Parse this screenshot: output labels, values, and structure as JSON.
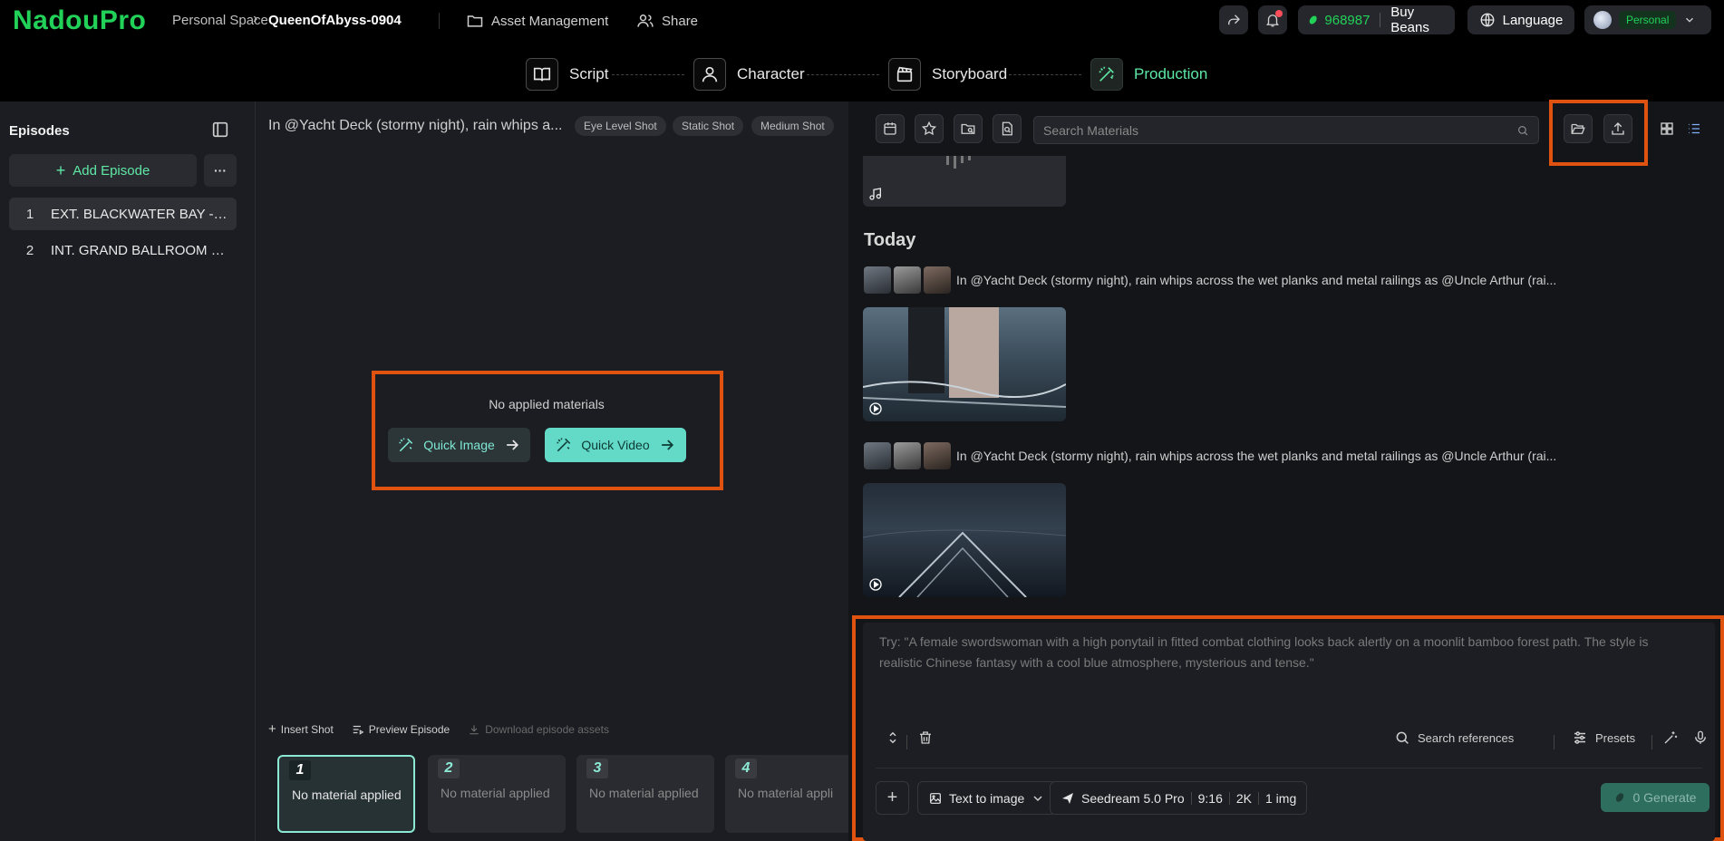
{
  "header": {
    "logo": "NadouPro",
    "breadcrumb_space": "Personal Space",
    "breadcrumb_project": "QueenOfAbyss-0904",
    "asset_management": "Asset Management",
    "share": "Share",
    "beans_count": "968987",
    "buy_beans": "Buy Beans",
    "language": "Language",
    "personal": "Personal"
  },
  "steps": [
    {
      "label": "Script",
      "icon": "book-icon"
    },
    {
      "label": "Character",
      "icon": "user-icon"
    },
    {
      "label": "Storyboard",
      "icon": "clapperboard-icon"
    },
    {
      "label": "Production",
      "icon": "wand-icon",
      "active": true
    }
  ],
  "sidebar": {
    "title": "Episodes",
    "add_episode": "Add Episode",
    "more": "···",
    "episodes": [
      {
        "num": "1",
        "name": "EXT. BLACKWATER BAY - N..."
      },
      {
        "num": "2",
        "name": "INT. GRAND BALLROOM - ..."
      }
    ]
  },
  "middle": {
    "title": "In @Yacht Deck (stormy night), rain whips a...",
    "tags": [
      "Eye Level Shot",
      "Static Shot",
      "Medium Shot"
    ],
    "empty_text": "No applied materials",
    "quick_image": "Quick Image",
    "quick_video": "Quick Video",
    "tools": {
      "insert_shot": "Insert Shot",
      "preview_episode": "Preview Episode",
      "download_assets": "Download episode assets"
    },
    "shots": [
      {
        "num": "1",
        "text": "No material applied"
      },
      {
        "num": "2",
        "text": "No material applied"
      },
      {
        "num": "3",
        "text": "No material applied"
      },
      {
        "num": "4",
        "text": "No material appli"
      }
    ]
  },
  "right": {
    "search_placeholder": "Search Materials",
    "today": "Today",
    "items": [
      {
        "prompt": "In @Yacht Deck (stormy night), rain whips across the wet planks and metal railings as @Uncle Arthur (rai..."
      },
      {
        "prompt": "In @Yacht Deck (stormy night), rain whips across the wet planks and metal railings as @Uncle Arthur (rai..."
      }
    ]
  },
  "composer": {
    "placeholder": "Try: \"A female swordswoman with a high ponytail in fitted combat clothing looks back alertly on a moonlit bamboo forest path. The style is realistic Chinese fantasy with a cool blue atmosphere, mysterious and tense.\"",
    "search_references": "Search references",
    "presets": "Presets",
    "mode": "Text to image",
    "model": "Seedream 5.0 Pro",
    "ratio": "9:16",
    "resolution": "2K",
    "count": "1 img",
    "generate": "0 Generate"
  },
  "colors": {
    "accent_green": "#22d158",
    "teal": "#63d9c8",
    "highlight": "#e0520f"
  }
}
